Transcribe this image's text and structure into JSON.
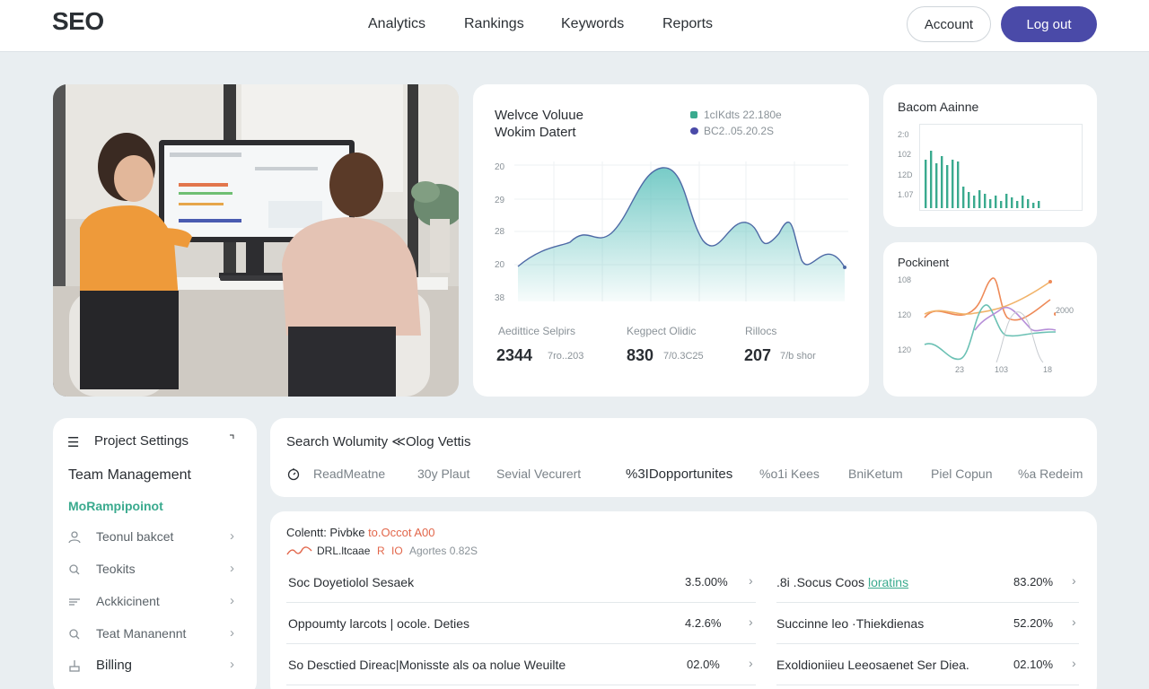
{
  "header": {
    "logo": "SEO",
    "nav": [
      "Analytics",
      "Rankings",
      "Keywords",
      "Reports"
    ],
    "account_label": "Account",
    "logout_label": "Log out",
    "accent": "#4a4aa8"
  },
  "volume_card": {
    "title_line1": "Welvce Voluue",
    "title_line2": "Wokim Datert",
    "legend1": "1cIKdts 22.180e",
    "legend2": "BC2..05.20.2S",
    "y_ticks": [
      "20",
      "29",
      "28",
      "20",
      "38"
    ],
    "stats": [
      {
        "label": "Aedittice Selpirs",
        "value": "2344",
        "sub": "7ro..203"
      },
      {
        "label": "Kegpect Olidic",
        "value": "830",
        "sub": "7/0.3C25"
      },
      {
        "label": "Rillocs",
        "value": "207",
        "sub": "7/b shor"
      }
    ],
    "color": "#5fc2bd"
  },
  "bars_card": {
    "title": "Bacom Aainne",
    "y_ticks": [
      "2:0",
      "102",
      "12D",
      "1.07"
    ],
    "color": "#3aaa8e"
  },
  "lines_card": {
    "title": "Pockinent",
    "y_ticks": [
      "108",
      "120",
      "120"
    ],
    "x_ticks": [
      "23",
      "103",
      "18"
    ],
    "right_label": "2000"
  },
  "sidebar": {
    "header": "Project Settings",
    "section1": "Team Management",
    "section2": "MoRampipoinot",
    "items": [
      {
        "label": "Teonul bakcet",
        "icon": "user-icon"
      },
      {
        "label": "Teokits",
        "icon": "search-icon"
      },
      {
        "label": "Ackkicinent",
        "icon": "filter-icon"
      },
      {
        "label": "Teat Mananennt",
        "icon": "search-icon"
      },
      {
        "label": "Billing",
        "icon": "billing-icon"
      }
    ]
  },
  "filter_card": {
    "title": "Search Wolumity ≪Olog Vettis",
    "tabs": [
      "ReadMeatne",
      "30y Plaut",
      "Sevial Vecurert",
      "%3IDopportunites",
      "%o1i Kees",
      "BniKetum",
      "Piel Copun",
      "%a Redeim"
    ]
  },
  "table_card": {
    "title_prefix": "Colentt: Pivbke",
    "title_accent": "to.Occot A00",
    "sub_a": "DRL.ltcaae",
    "sub_b": "R",
    "sub_c": "IO",
    "sub_d": "Agortes 0.82S",
    "left_rows": [
      {
        "name": "Soc Doyetiolol Sesaek",
        "value": "3.5.00%"
      },
      {
        "name": "Oppoumty larcots | ocole. Deties",
        "value": "4.2.6%"
      },
      {
        "name": "So Desctied Direac|Monisste als oa nolue Weuilte",
        "value": "02.0%"
      }
    ],
    "right_rows": [
      {
        "name": ".8i .Socus Coos",
        "link": "loratins",
        "value": "83.20%"
      },
      {
        "name": "Succinne leo ·Thiekdienas",
        "value": "52.20%"
      },
      {
        "name": "Exoldioniieu Leeosaenet Ser Diea.",
        "value": "02.10%"
      }
    ],
    "accent": "#e2664a"
  }
}
